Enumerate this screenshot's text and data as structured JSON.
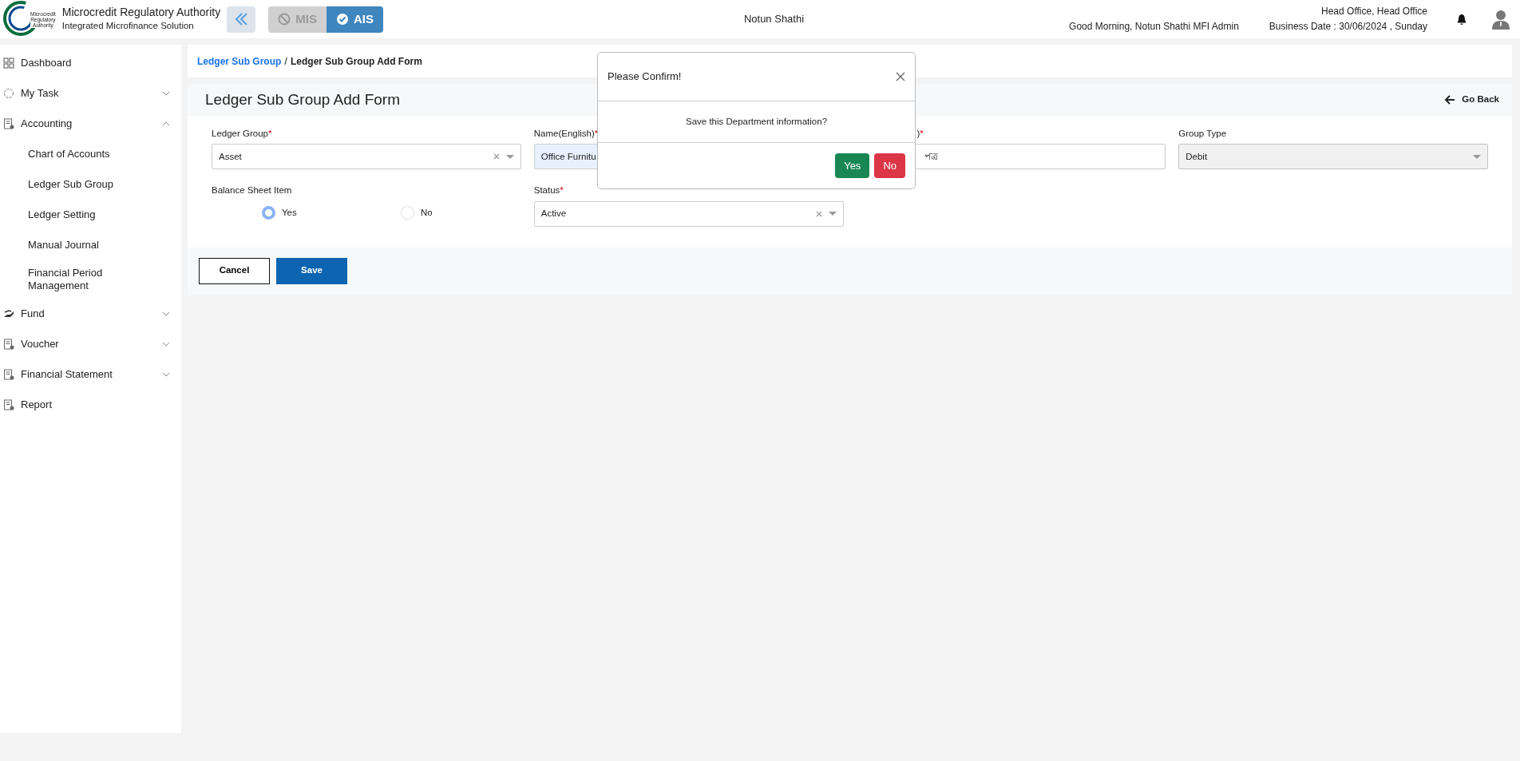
{
  "header": {
    "org_name": "Microcredit Regulatory Authority",
    "org_subtitle": "Integrated Microfinance Solution",
    "logo_text": [
      "Microcredit",
      "Regulatory",
      "Authority"
    ],
    "modules": [
      {
        "label": "MIS",
        "selected": false
      },
      {
        "label": "AIS",
        "selected": true
      }
    ],
    "center_title": "Notun Shathi",
    "greeting": "Good Morning, Notun Shathi MFI Admin",
    "office": "Head Office, Head Office",
    "business_date": "Business Date : 30/06/2024 , Sunday"
  },
  "sidebar": {
    "items": [
      {
        "label": "Dashboard",
        "kind": "grid"
      },
      {
        "label": "My Task",
        "kind": "circle",
        "expanded": false
      },
      {
        "label": "Accounting",
        "kind": "doc",
        "expanded": true,
        "children": [
          {
            "label": "Chart of Accounts"
          },
          {
            "label": "Ledger Sub Group"
          },
          {
            "label": "Ledger Setting"
          },
          {
            "label": "Manual Journal"
          },
          {
            "label": "Financial Period Management"
          }
        ]
      },
      {
        "label": "Fund",
        "kind": "hand",
        "expanded": false
      },
      {
        "label": "Voucher",
        "kind": "doc",
        "expanded": false
      },
      {
        "label": "Financial Statement",
        "kind": "doc",
        "expanded": false
      },
      {
        "label": "Report",
        "kind": "doc"
      }
    ]
  },
  "breadcrumb": {
    "separator": "/",
    "items": [
      {
        "label": "Ledger Sub Group",
        "link": true
      },
      {
        "label": "Ledger Sub Group Add Form",
        "link": false
      }
    ]
  },
  "form": {
    "title": "Ledger Sub Group Add Form",
    "back": "Go Back",
    "required_marker": "*",
    "fields": [
      {
        "kind": "select",
        "label": "Ledger Group",
        "required": true,
        "value": "Asset",
        "clearable": true,
        "disabled": false
      },
      {
        "kind": "text",
        "label": "Name(English)",
        "required": true,
        "value": "Office Furnitu",
        "autofilled": true
      },
      {
        "kind": "text",
        "label": ")",
        "required": true,
        "value": "পত্র",
        "autofilled": false
      },
      {
        "kind": "select",
        "label": "Group Type",
        "required": false,
        "value": "Debit",
        "clearable": false,
        "disabled": true
      },
      {
        "kind": "radio",
        "label": "Balance Sheet Item",
        "required": false,
        "options": [
          {
            "label": "Yes",
            "selected": true
          },
          {
            "label": "No",
            "selected": false
          }
        ]
      },
      {
        "kind": "select",
        "label": "Status",
        "required": true,
        "value": "Active",
        "clearable": true,
        "disabled": false
      }
    ],
    "buttons": [
      {
        "label": "Cancel",
        "kind": "outline"
      },
      {
        "label": "Save",
        "kind": "primary"
      }
    ]
  },
  "modal": {
    "title": "Please Confirm!",
    "message": "Save this Department information?",
    "buttons": [
      {
        "label": "Yes",
        "kind": "success"
      },
      {
        "label": "No",
        "kind": "danger"
      }
    ]
  }
}
